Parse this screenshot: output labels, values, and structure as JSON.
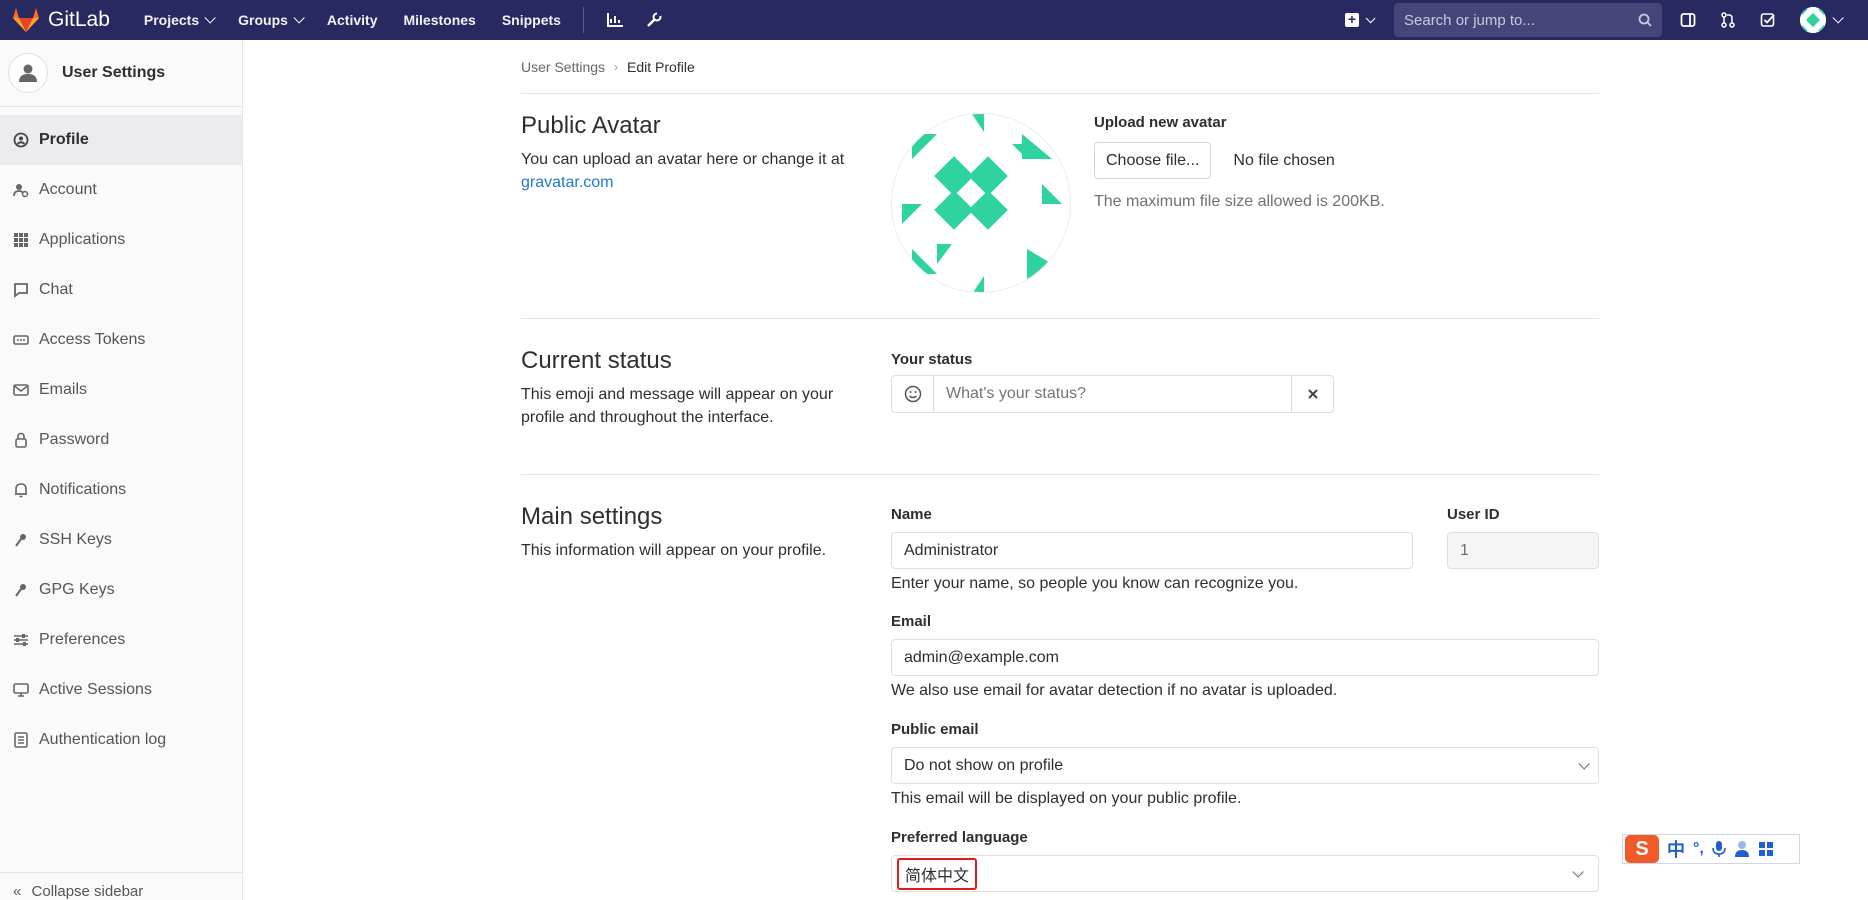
{
  "navbar": {
    "brand": "GitLab",
    "links": [
      {
        "label": "Projects",
        "dropdown": true
      },
      {
        "label": "Groups",
        "dropdown": true
      },
      {
        "label": "Activity",
        "dropdown": false
      },
      {
        "label": "Milestones",
        "dropdown": false
      },
      {
        "label": "Snippets",
        "dropdown": false
      }
    ],
    "search_placeholder": "Search or jump to...",
    "bg_color": "#292961",
    "icons": [
      "chart-icon",
      "wrench-icon",
      "plus-square-icon",
      "search-icon",
      "sidebar-icon",
      "merge-request-icon",
      "todo-check-icon"
    ]
  },
  "sidebar": {
    "title": "User Settings",
    "items": [
      {
        "label": "Profile",
        "icon": "profile-icon",
        "active": true
      },
      {
        "label": "Account",
        "icon": "account-icon",
        "active": false
      },
      {
        "label": "Applications",
        "icon": "applications-icon",
        "active": false
      },
      {
        "label": "Chat",
        "icon": "chat-icon",
        "active": false
      },
      {
        "label": "Access Tokens",
        "icon": "token-icon",
        "active": false
      },
      {
        "label": "Emails",
        "icon": "mail-icon",
        "active": false
      },
      {
        "label": "Password",
        "icon": "lock-icon",
        "active": false
      },
      {
        "label": "Notifications",
        "icon": "bell-icon",
        "active": false
      },
      {
        "label": "SSH Keys",
        "icon": "key-icon",
        "active": false
      },
      {
        "label": "GPG Keys",
        "icon": "key-icon",
        "active": false
      },
      {
        "label": "Preferences",
        "icon": "sliders-icon",
        "active": false
      },
      {
        "label": "Active Sessions",
        "icon": "monitor-icon",
        "active": false
      },
      {
        "label": "Authentication log",
        "icon": "log-icon",
        "active": false
      }
    ],
    "collapse_label": "Collapse sidebar"
  },
  "breadcrumb": {
    "parent": "User Settings",
    "current": "Edit Profile"
  },
  "avatar_section": {
    "title": "Public Avatar",
    "desc": "You can upload an avatar here or change it at",
    "link": "gravatar.com",
    "upload_label": "Upload new avatar",
    "choose_button": "Choose file...",
    "no_file": "No file chosen",
    "max_size": "The maximum file size allowed is 200KB.",
    "accent": "#2ed3a0"
  },
  "status_section": {
    "title": "Current status",
    "desc": "This emoji and message will appear on your profile and throughout the interface.",
    "label": "Your status",
    "placeholder": "What's your status?"
  },
  "main_section": {
    "title": "Main settings",
    "desc": "This information will appear on your profile.",
    "name_label": "Name",
    "name_value": "Administrator",
    "name_help": "Enter your name, so people you know can recognize you.",
    "userid_label": "User ID",
    "userid_value": "1",
    "email_label": "Email",
    "email_value": "admin@example.com",
    "email_help": "We also use email for avatar detection if no avatar is uploaded.",
    "public_email_label": "Public email",
    "public_email_value": "Do not show on profile",
    "public_email_help": "This email will be displayed on your public profile.",
    "language_label": "Preferred language",
    "language_value": "简体中文"
  },
  "ime_toolbar": {
    "lang": "中"
  }
}
